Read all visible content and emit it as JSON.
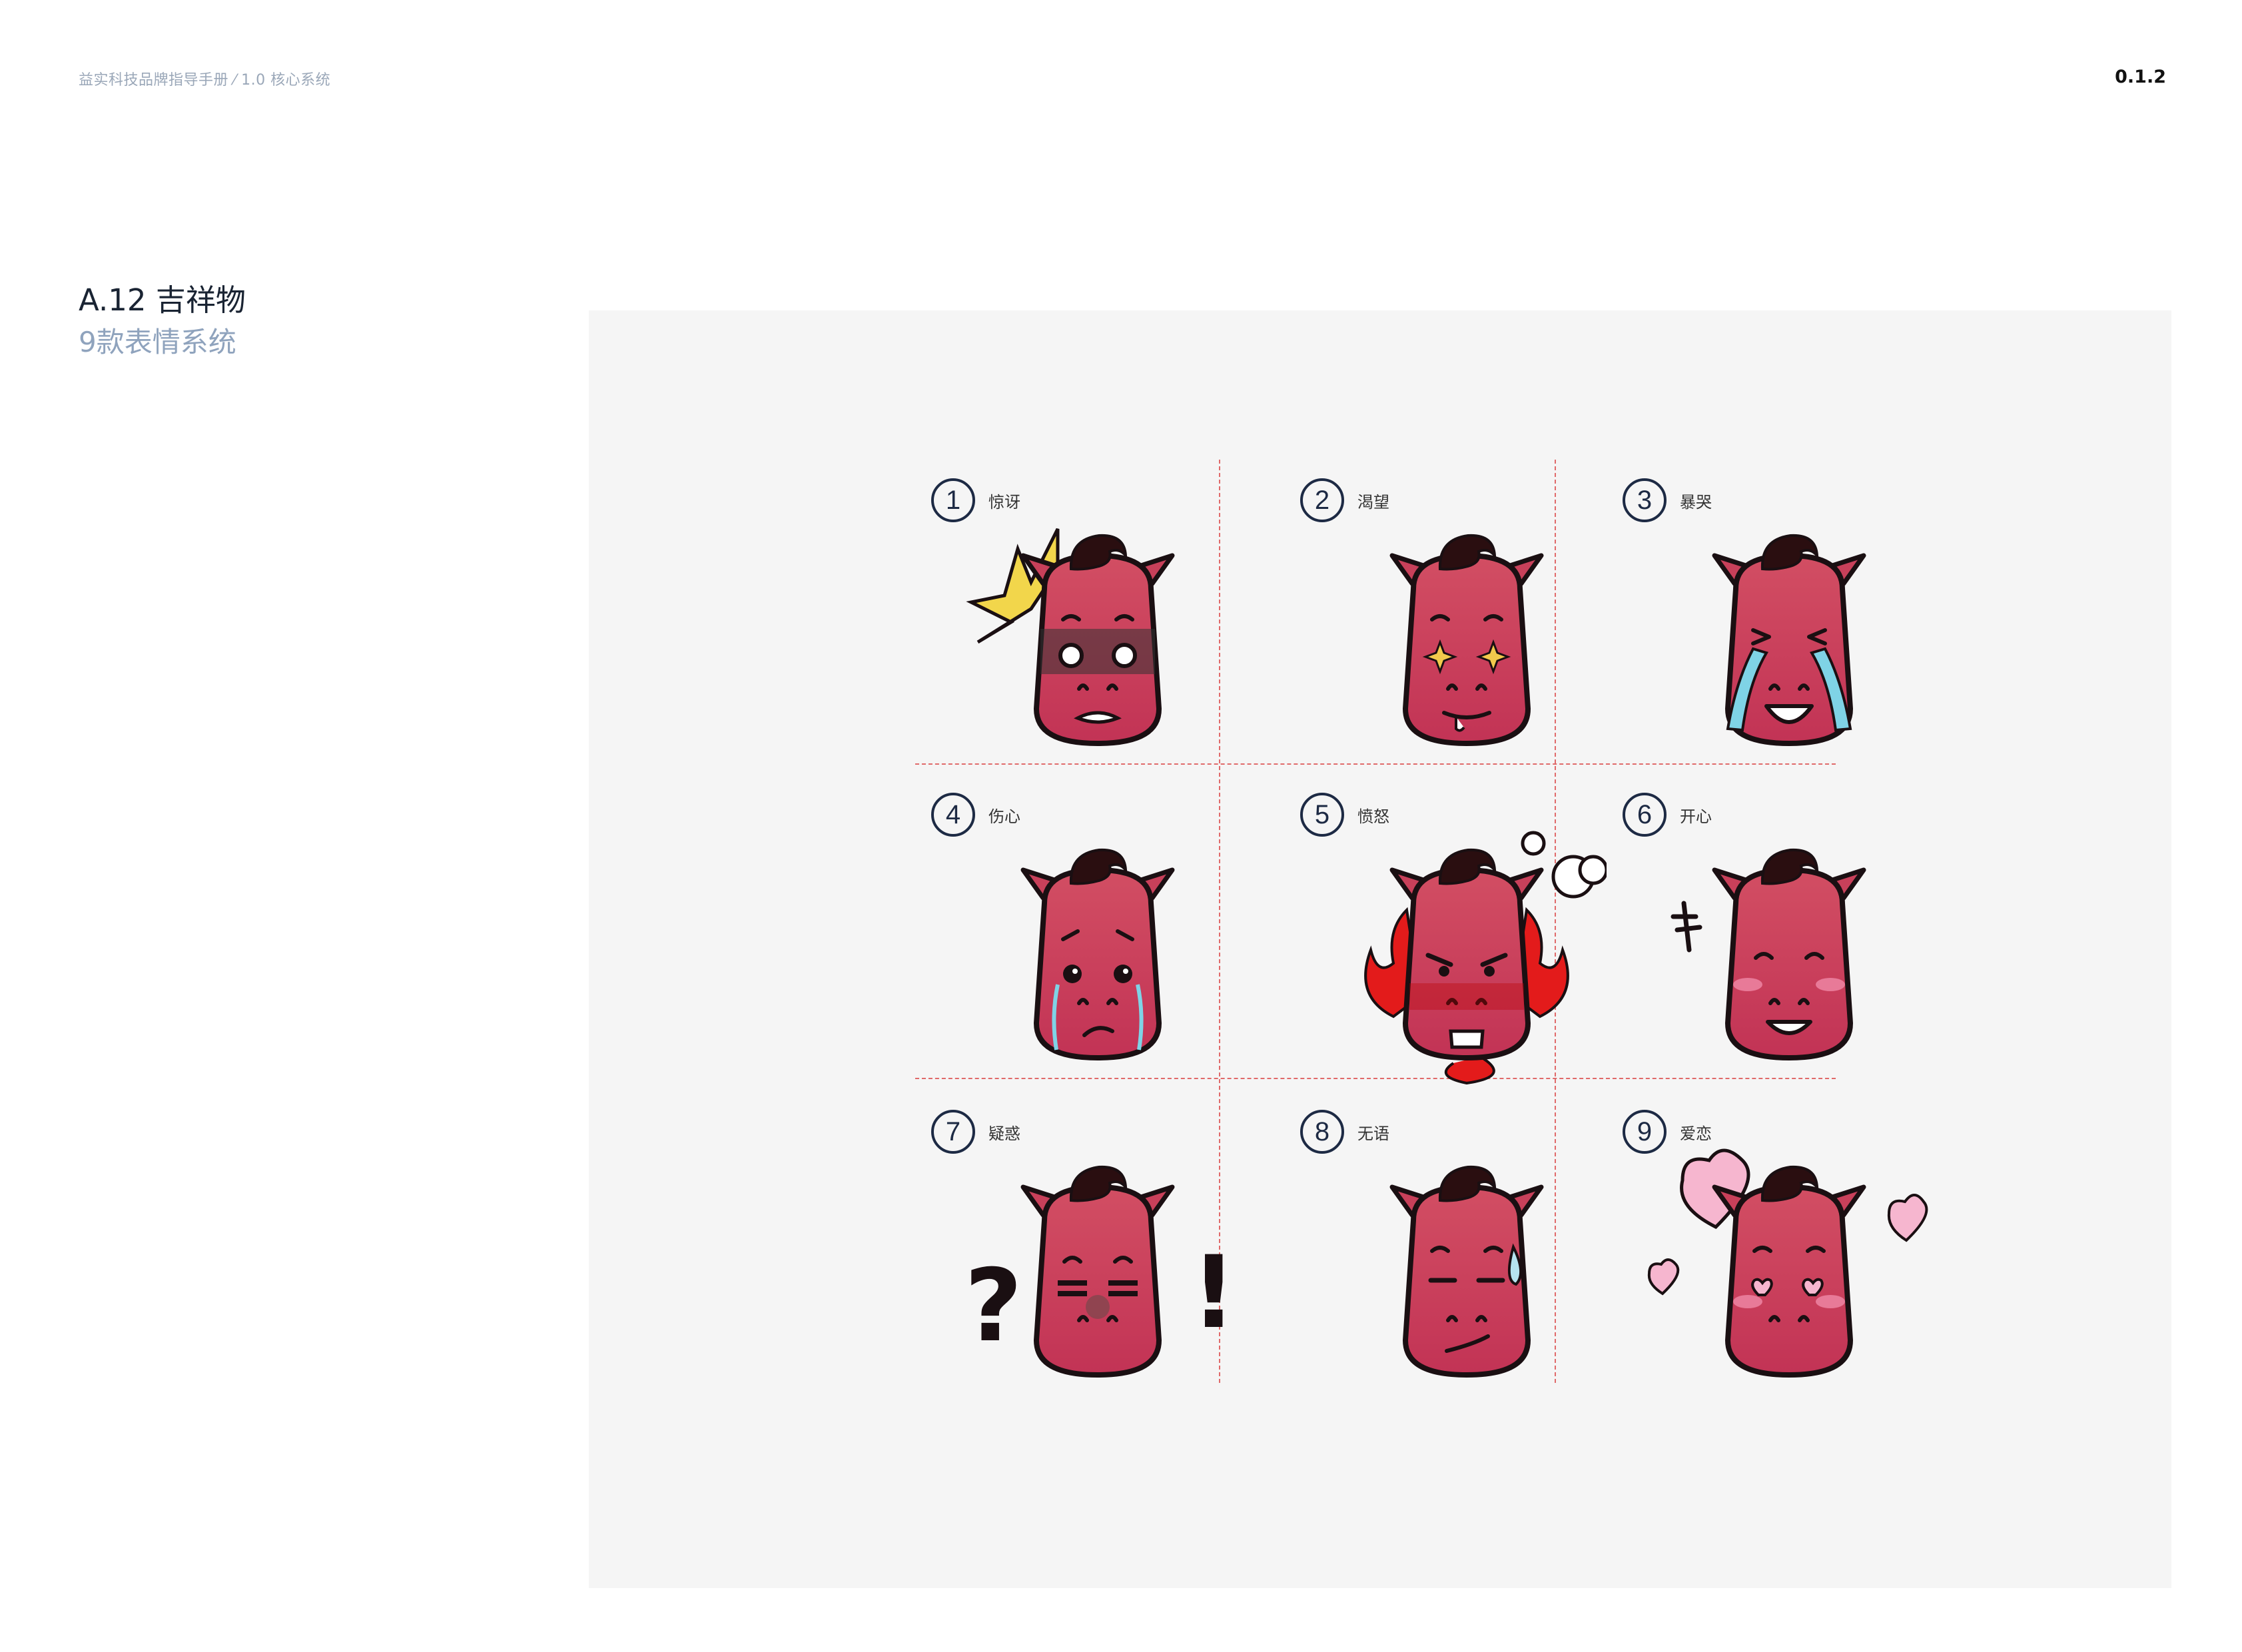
{
  "header": {
    "breadcrumb": "益实科技品牌指导手册 ⁄ 1.0 核心系统",
    "page_number": "0.1.2"
  },
  "section": {
    "title": "A.12 吉祥物",
    "subtitle": "9款表情系统"
  },
  "colors": {
    "face": "#c8405a",
    "outline": "#1a0f12",
    "hair": "#2a0e10",
    "grid_line": "#e06a6a",
    "badge": "#1d2a44",
    "panel": "#f5f5f5"
  },
  "emotions": [
    {
      "number": "1",
      "label": "惊讶",
      "icon": "surprised-mascot-icon"
    },
    {
      "number": "2",
      "label": "渴望",
      "icon": "longing-mascot-icon"
    },
    {
      "number": "3",
      "label": "暴哭",
      "icon": "crying-mascot-icon"
    },
    {
      "number": "4",
      "label": "伤心",
      "icon": "sad-mascot-icon"
    },
    {
      "number": "5",
      "label": "愤怒",
      "icon": "angry-mascot-icon"
    },
    {
      "number": "6",
      "label": "开心",
      "icon": "happy-mascot-icon"
    },
    {
      "number": "7",
      "label": "疑惑",
      "icon": "confused-mascot-icon"
    },
    {
      "number": "8",
      "label": "无语",
      "icon": "speechless-mascot-icon"
    },
    {
      "number": "9",
      "label": "爱恋",
      "icon": "love-mascot-icon"
    }
  ]
}
